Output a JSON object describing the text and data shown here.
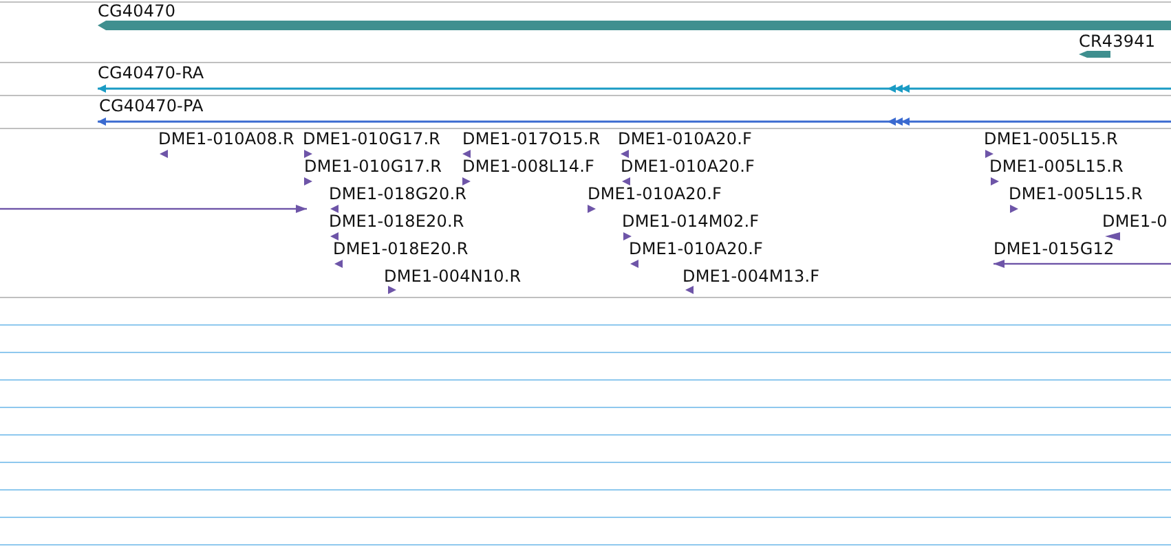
{
  "tracks": [
    {
      "kind": "gene",
      "features": [
        {
          "label": "CG40470",
          "reverse": true
        },
        {
          "label": "CR43941",
          "reverse": true
        }
      ]
    },
    {
      "kind": "transcript",
      "features": [
        {
          "label": "CG40470-RA",
          "reverse": true
        }
      ]
    },
    {
      "kind": "protein",
      "features": [
        {
          "label": "CG40470-PA",
          "reverse": true
        }
      ]
    },
    {
      "kind": "clone",
      "features": [
        {
          "label": "DME1-010A08.R",
          "reverse": true
        },
        {
          "label": "DME1-010G17.R",
          "reverse": false
        },
        {
          "label": "DME1-017O15.R",
          "reverse": true
        },
        {
          "label": "DME1-010A20.F",
          "reverse": true
        },
        {
          "label": "DME1-005L15.R",
          "reverse": false
        },
        {
          "label": "DME1-010G17.R",
          "reverse": false
        },
        {
          "label": "DME1-008L14.F",
          "reverse": false
        },
        {
          "label": "DME1-010A20.F",
          "reverse": true
        },
        {
          "label": "DME1-005L15.R",
          "reverse": false
        },
        {
          "reverse": false
        },
        {
          "label": "DME1-018G20.R",
          "reverse": true
        },
        {
          "label": "DME1-010A20.F",
          "reverse": false
        },
        {
          "label": "DME1-005L15.R",
          "reverse": false
        },
        {
          "label": "DME1-018E20.R",
          "reverse": true
        },
        {
          "label": "DME1-014M02.F",
          "reverse": false
        },
        {
          "label": "DME1-0",
          "reverse": true
        },
        {
          "label": "DME1-018E20.R",
          "reverse": true
        },
        {
          "label": "DME1-010A20.F",
          "reverse": true
        },
        {
          "label": "DME1-015G12",
          "reverse": true
        },
        {
          "label": "DME1-004N10.R",
          "reverse": false
        },
        {
          "label": "DME1-004M13.F",
          "reverse": true
        }
      ]
    }
  ]
}
